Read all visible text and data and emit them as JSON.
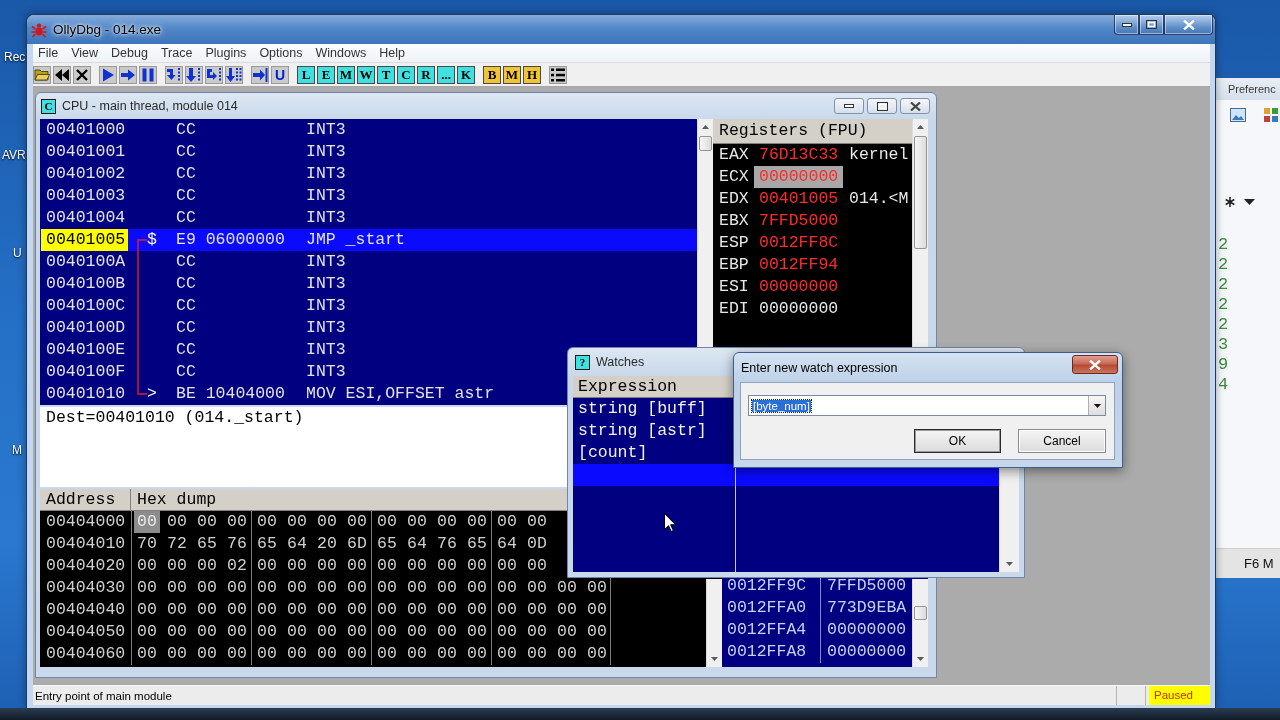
{
  "desktop": {
    "icon_labels": [
      "Rec",
      "AVR",
      "U",
      "M"
    ]
  },
  "background_window": {
    "title": "Preferenc",
    "list_values": [
      "2",
      "2",
      "2",
      "2",
      "2",
      "3",
      "9",
      "4"
    ],
    "footer": "F6 M"
  },
  "window": {
    "title": "OllyDbg - 014.exe"
  },
  "menu": [
    "File",
    "View",
    "Debug",
    "Trace",
    "Plugins",
    "Options",
    "Windows",
    "Help"
  ],
  "toolbar": [
    [
      {
        "kind": "icon"
      },
      {
        "kind": "icon"
      },
      {
        "kind": "icon"
      }
    ],
    [
      {
        "kind": "icon"
      },
      {
        "kind": "icon"
      },
      {
        "kind": "icon"
      }
    ],
    [
      {
        "kind": "icon"
      },
      {
        "kind": "icon"
      },
      {
        "kind": "icon"
      },
      {
        "kind": "icon"
      }
    ],
    [
      {
        "kind": "icon"
      },
      {
        "kind": "glyph",
        "label": "U"
      }
    ],
    [
      {
        "kind": "letter",
        "label": "L",
        "color": "#3ee0e0"
      },
      {
        "kind": "letter",
        "label": "E",
        "color": "#3ee0e0"
      },
      {
        "kind": "letter",
        "label": "M",
        "color": "#3ee0e0"
      },
      {
        "kind": "letter",
        "label": "W",
        "color": "#3ee0e0"
      },
      {
        "kind": "letter",
        "label": "T",
        "color": "#3ee0e0"
      },
      {
        "kind": "letter",
        "label": "C",
        "color": "#3ee0e0"
      },
      {
        "kind": "letter",
        "label": "R",
        "color": "#3ee0e0"
      },
      {
        "kind": "letter",
        "label": "...",
        "color": "#3ee0e0"
      },
      {
        "kind": "letter",
        "label": "K",
        "color": "#3ee0e0"
      }
    ],
    [
      {
        "kind": "letter",
        "label": "B",
        "color": "#f2c434"
      },
      {
        "kind": "letter",
        "label": "M",
        "color": "#f2c434"
      },
      {
        "kind": "letter",
        "label": "H",
        "color": "#f2c434"
      }
    ],
    [
      {
        "kind": "icon"
      }
    ]
  ],
  "cpu_window": {
    "tag": "C",
    "title": "CPU - main thread, module 014",
    "disassembly": {
      "rows": [
        {
          "address": "00401000",
          "hex": "CC",
          "command": "INT3",
          "selected": false,
          "jump_start": false,
          "jump_end": false
        },
        {
          "address": "00401001",
          "hex": "CC",
          "command": "INT3",
          "selected": false,
          "jump_start": false,
          "jump_end": false
        },
        {
          "address": "00401002",
          "hex": "CC",
          "command": "INT3",
          "selected": false,
          "jump_start": false,
          "jump_end": false
        },
        {
          "address": "00401003",
          "hex": "CC",
          "command": "INT3",
          "selected": false,
          "jump_start": false,
          "jump_end": false
        },
        {
          "address": "00401004",
          "hex": "CC",
          "command": "INT3",
          "selected": false,
          "jump_start": false,
          "jump_end": false
        },
        {
          "address": "00401005",
          "marker": "$",
          "hex": "E9 06000000",
          "command": "JMP _start",
          "selected": true,
          "jump_start": true,
          "jump_end": false
        },
        {
          "address": "0040100A",
          "hex": "CC",
          "command": "INT3",
          "selected": false,
          "jump_start": false,
          "jump_end": false
        },
        {
          "address": "0040100B",
          "hex": "CC",
          "command": "INT3",
          "selected": false,
          "jump_start": false,
          "jump_end": false
        },
        {
          "address": "0040100C",
          "hex": "CC",
          "command": "INT3",
          "selected": false,
          "jump_start": false,
          "jump_end": false
        },
        {
          "address": "0040100D",
          "hex": "CC",
          "command": "INT3",
          "selected": false,
          "jump_start": false,
          "jump_end": false
        },
        {
          "address": "0040100E",
          "hex": "CC",
          "command": "INT3",
          "selected": false,
          "jump_start": false,
          "jump_end": false
        },
        {
          "address": "0040100F",
          "hex": "CC",
          "command": "INT3",
          "selected": false,
          "jump_start": false,
          "jump_end": false
        },
        {
          "address": "00401010",
          "marker": ">",
          "hex": "BE 10404000",
          "command": "MOV ESI,OFFSET astr",
          "selected": false,
          "jump_start": false,
          "jump_end": true
        }
      ]
    },
    "info": "Dest=00401010 (014._start)",
    "registers": {
      "title": "Registers (FPU)",
      "rows": [
        {
          "name": "EAX",
          "value": "76D13C33",
          "comment": "kernel",
          "changed": true,
          "selected": false
        },
        {
          "name": "ECX",
          "value": "00000000",
          "changed": true,
          "selected": true
        },
        {
          "name": "EDX",
          "value": "00401005",
          "comment": "014.<M",
          "changed": true,
          "selected": false
        },
        {
          "name": "EBX",
          "value": "7FFD5000",
          "changed": true,
          "selected": false
        },
        {
          "name": "ESP",
          "value": "0012FF8C",
          "changed": true,
          "selected": false
        },
        {
          "name": "EBP",
          "value": "0012FF94",
          "changed": true,
          "selected": false
        },
        {
          "name": "ESI",
          "value": "00000000",
          "changed": true,
          "selected": false
        },
        {
          "name": "EDI",
          "value": "00000000",
          "changed": false,
          "selected": false
        }
      ]
    },
    "dump": {
      "columns": [
        "Address",
        "Hex dump"
      ],
      "rows": [
        {
          "address": "00404000",
          "bytes": [
            {
              "value": "00",
              "selected": true
            },
            {
              "value": "00",
              "selected": false
            },
            {
              "value": "00",
              "selected": false
            },
            {
              "value": "00",
              "selected": false
            },
            {
              "value": "00",
              "selected": false
            },
            {
              "value": "00",
              "selected": false
            },
            {
              "value": "00",
              "selected": false
            },
            {
              "value": "00",
              "selected": false
            },
            {
              "value": "00",
              "selected": false
            },
            {
              "value": "00",
              "selected": false
            },
            {
              "value": "00",
              "selected": false
            },
            {
              "value": "00",
              "selected": false
            },
            {
              "value": "00",
              "selected": false
            },
            {
              "value": "00",
              "selected": false
            }
          ]
        },
        {
          "address": "00404010",
          "bytes": [
            {
              "value": "70",
              "selected": false
            },
            {
              "value": "72",
              "selected": false
            },
            {
              "value": "65",
              "selected": false
            },
            {
              "value": "76",
              "selected": false
            },
            {
              "value": "65",
              "selected": false
            },
            {
              "value": "64",
              "selected": false
            },
            {
              "value": "20",
              "selected": false
            },
            {
              "value": "6D",
              "selected": false
            },
            {
              "value": "65",
              "selected": false
            },
            {
              "value": "64",
              "selected": false
            },
            {
              "value": "76",
              "selected": false
            },
            {
              "value": "65",
              "selected": false
            },
            {
              "value": "64",
              "selected": false
            },
            {
              "value": "0D",
              "selected": false
            }
          ]
        },
        {
          "address": "00404020",
          "bytes": [
            {
              "value": "00",
              "selected": false
            },
            {
              "value": "00",
              "selected": false
            },
            {
              "value": "00",
              "selected": false
            },
            {
              "value": "02",
              "selected": false
            },
            {
              "value": "00",
              "selected": false
            },
            {
              "value": "00",
              "selected": false
            },
            {
              "value": "00",
              "selected": false
            },
            {
              "value": "00",
              "selected": false
            },
            {
              "value": "00",
              "selected": false
            },
            {
              "value": "00",
              "selected": false
            },
            {
              "value": "00",
              "selected": false
            },
            {
              "value": "00",
              "selected": false
            },
            {
              "value": "00",
              "selected": false
            },
            {
              "value": "00",
              "selected": false
            }
          ]
        },
        {
          "address": "00404030",
          "bytes": [
            {
              "value": "00",
              "selected": false
            },
            {
              "value": "00",
              "selected": false
            },
            {
              "value": "00",
              "selected": false
            },
            {
              "value": "00",
              "selected": false
            },
            {
              "value": "00",
              "selected": false
            },
            {
              "value": "00",
              "selected": false
            },
            {
              "value": "00",
              "selected": false
            },
            {
              "value": "00",
              "selected": false
            },
            {
              "value": "00",
              "selected": false
            },
            {
              "value": "00",
              "selected": false
            },
            {
              "value": "00",
              "selected": false
            },
            {
              "value": "00",
              "selected": false
            },
            {
              "value": "00",
              "selected": false
            },
            {
              "value": "00",
              "selected": false
            },
            {
              "value": "00",
              "selected": false
            },
            {
              "value": "00",
              "selected": false
            }
          ]
        },
        {
          "address": "00404040",
          "bytes": [
            {
              "value": "00",
              "selected": false
            },
            {
              "value": "00",
              "selected": false
            },
            {
              "value": "00",
              "selected": false
            },
            {
              "value": "00",
              "selected": false
            },
            {
              "value": "00",
              "selected": false
            },
            {
              "value": "00",
              "selected": false
            },
            {
              "value": "00",
              "selected": false
            },
            {
              "value": "00",
              "selected": false
            },
            {
              "value": "00",
              "selected": false
            },
            {
              "value": "00",
              "selected": false
            },
            {
              "value": "00",
              "selected": false
            },
            {
              "value": "00",
              "selected": false
            },
            {
              "value": "00",
              "selected": false
            },
            {
              "value": "00",
              "selected": false
            },
            {
              "value": "00",
              "selected": false
            },
            {
              "value": "00",
              "selected": false
            }
          ]
        },
        {
          "address": "00404050",
          "bytes": [
            {
              "value": "00",
              "selected": false
            },
            {
              "value": "00",
              "selected": false
            },
            {
              "value": "00",
              "selected": false
            },
            {
              "value": "00",
              "selected": false
            },
            {
              "value": "00",
              "selected": false
            },
            {
              "value": "00",
              "selected": false
            },
            {
              "value": "00",
              "selected": false
            },
            {
              "value": "00",
              "selected": false
            },
            {
              "value": "00",
              "selected": false
            },
            {
              "value": "00",
              "selected": false
            },
            {
              "value": "00",
              "selected": false
            },
            {
              "value": "00",
              "selected": false
            },
            {
              "value": "00",
              "selected": false
            },
            {
              "value": "00",
              "selected": false
            },
            {
              "value": "00",
              "selected": false
            },
            {
              "value": "00",
              "selected": false
            }
          ]
        },
        {
          "address": "00404060",
          "bytes": [
            {
              "value": "00",
              "selected": false
            },
            {
              "value": "00",
              "selected": false
            },
            {
              "value": "00",
              "selected": false
            },
            {
              "value": "00",
              "selected": false
            },
            {
              "value": "00",
              "selected": false
            },
            {
              "value": "00",
              "selected": false
            },
            {
              "value": "00",
              "selected": false
            },
            {
              "value": "00",
              "selected": false
            },
            {
              "value": "00",
              "selected": false
            },
            {
              "value": "00",
              "selected": false
            },
            {
              "value": "00",
              "selected": false
            },
            {
              "value": "00",
              "selected": false
            },
            {
              "value": "00",
              "selected": false
            },
            {
              "value": "00",
              "selected": false
            },
            {
              "value": "00",
              "selected": false
            },
            {
              "value": "00",
              "selected": false
            }
          ]
        }
      ]
    },
    "stack": {
      "rows": [
        {
          "address": "0012FF9C",
          "value": "7FFD5000"
        },
        {
          "address": "0012FFA0",
          "value": "773D9EBA"
        },
        {
          "address": "0012FFA4",
          "value": "00000000"
        },
        {
          "address": "0012FFA8",
          "value": "00000000"
        }
      ]
    }
  },
  "watches_window": {
    "tag": "?",
    "title": "Watches",
    "columns": [
      "Expression"
    ],
    "rows": [
      {
        "expression": "string [buff]",
        "selected": false
      },
      {
        "expression": "string [astr]",
        "selected": false
      },
      {
        "expression": "[count]",
        "selected": false
      },
      {
        "selected": true
      }
    ]
  },
  "dialog": {
    "title": "Enter new watch expression",
    "input": {
      "value": "[byte_num]",
      "text_selected": true
    },
    "buttons": [
      {
        "label": "OK",
        "default": true
      },
      {
        "label": "Cancel",
        "default": false
      }
    ]
  },
  "status_bar": {
    "message": "Entry point of main module",
    "state": "Paused"
  }
}
